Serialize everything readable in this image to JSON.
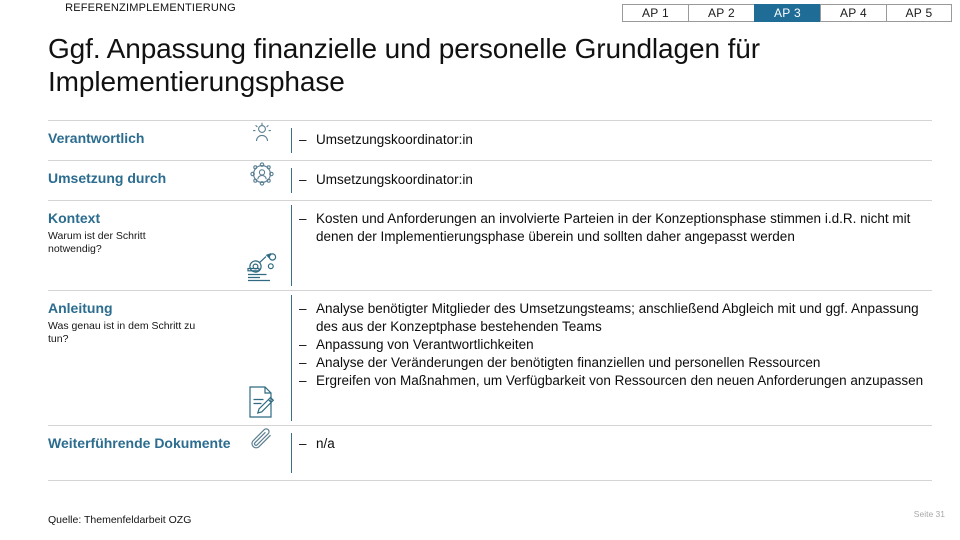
{
  "header": {
    "kicker": "REFERENZIMPLEMENTIERUNG",
    "title": "Ggf. Anpassung finanzielle und personelle Grundlagen für Implementierungsphase",
    "accent_color": "#2B6C8F",
    "active_tab_color": "#1F6C97"
  },
  "tabs": [
    {
      "label": "AP 1",
      "active": false
    },
    {
      "label": "AP 2",
      "active": false
    },
    {
      "label": "AP 3",
      "active": true
    },
    {
      "label": "AP 4",
      "active": false
    },
    {
      "label": "AP 5",
      "active": false
    }
  ],
  "rows": [
    {
      "label": "Verantwortlich",
      "sublabel": "",
      "icon": "person-icon",
      "bullets": [
        "Umsetzungskoordinator:in"
      ]
    },
    {
      "label": "Umsetzung durch",
      "sublabel": "",
      "icon": "group-gear-icon",
      "bullets": [
        "Umsetzungskoordinator:in"
      ]
    },
    {
      "label": "Kontext",
      "sublabel": "Warum ist der Schritt notwendig?",
      "icon": "document-magnifier-icon",
      "bullets": [
        "Kosten und Anforderungen an involvierte Parteien in der Konzeptionsphase stimmen i.d.R. nicht mit denen der Implementierungsphase überein und sollten daher angepasst werden"
      ]
    },
    {
      "label": "Anleitung",
      "sublabel": "Was genau ist in dem Schritt zu tun?",
      "icon": "document-pencil-icon",
      "bullets": [
        "Analyse benötigter Mitglieder des Umsetzungsteams; anschließend Abgleich mit und ggf. Anpassung des aus der Konzeptphase bestehenden Teams",
        "Anpassung von Verantwortlichkeiten",
        "Analyse der Veränderungen der benötigten finanziellen und personellen Ressourcen",
        "Ergreifen von Maßnahmen, um Verfügbarkeit von Ressourcen den neuen Anforderungen anzupassen"
      ]
    },
    {
      "label": "Weiterführende Dokumente",
      "sublabel": "",
      "icon": "paperclip-icon",
      "bullets": [
        "n/a"
      ]
    }
  ],
  "footer": {
    "source": "Quelle: Themenfeldarbeit OZG",
    "page": "Seite 31"
  }
}
